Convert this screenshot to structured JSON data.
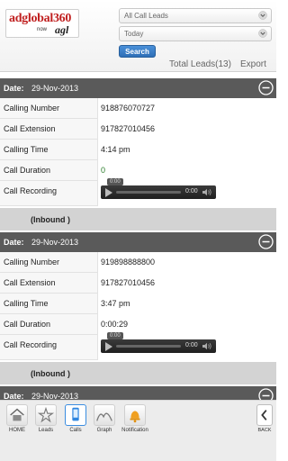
{
  "header": {
    "logo_brand": "adglobal360",
    "logo_sub": "now",
    "logo_agl": "agl",
    "filter_leads": "All Call Leads",
    "filter_period": "Today",
    "search_label": "Search",
    "total_leads": "Total Leads(13)",
    "export_label": "Export"
  },
  "records": [
    {
      "date_label": "Date:",
      "date": "29-Nov-2013",
      "fields": {
        "calling_number_label": "Calling Number",
        "calling_number": "918876070727",
        "calling_extension_label": "Call Extension",
        "calling_extension": "917827010456",
        "calling_time_label": "Calling Time",
        "calling_time": "4:14 pm",
        "call_duration_label": "Call Duration",
        "call_duration": "0",
        "call_recording_label": "Call Recording",
        "recording_current": "0:00",
        "recording_total": "0:00"
      },
      "direction": "(Inbound )"
    },
    {
      "date_label": "Date:",
      "date": "29-Nov-2013",
      "fields": {
        "calling_number_label": "Calling Number",
        "calling_number": "919898888800",
        "calling_extension_label": "Call Extension",
        "calling_extension": "917827010456",
        "calling_time_label": "Calling Time",
        "calling_time": "3:47 pm",
        "call_duration_label": "Call Duration",
        "call_duration": "0:00:29",
        "call_recording_label": "Call Recording",
        "recording_current": "0:00",
        "recording_total": "0:00"
      },
      "direction": "(Inbound )"
    },
    {
      "date_label": "Date:",
      "date": "29-Nov-2013"
    }
  ],
  "nav": {
    "home": "HOME",
    "leads": "Leads",
    "calls": "Calls",
    "graph": "Graph",
    "notification": "Notification",
    "back": "BACK"
  },
  "colors": {
    "datebar": "#5a5a5a",
    "search_button": "#3a80c8",
    "active_nav": "#3b8de0",
    "brand_red": "#c01f1f"
  }
}
